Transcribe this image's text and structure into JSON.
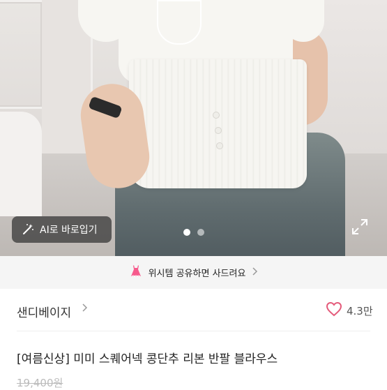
{
  "photo": {
    "ai_button_label": "AI로 바로입기",
    "carousel_total": 2,
    "carousel_active": 1
  },
  "share_bar": {
    "label": "위시템 공유하면 사드려요"
  },
  "store": {
    "name": "샌디베이지",
    "chevron": ">",
    "like_count": "4.3만"
  },
  "product": {
    "title": "[여름신상] 미미 스퀘어넥 콩단추 리본 반팔 블라우스",
    "original_price": "19,400원"
  },
  "colors": {
    "accent_pink": "#F65A8C",
    "heart_outline": "#E45A7A"
  }
}
